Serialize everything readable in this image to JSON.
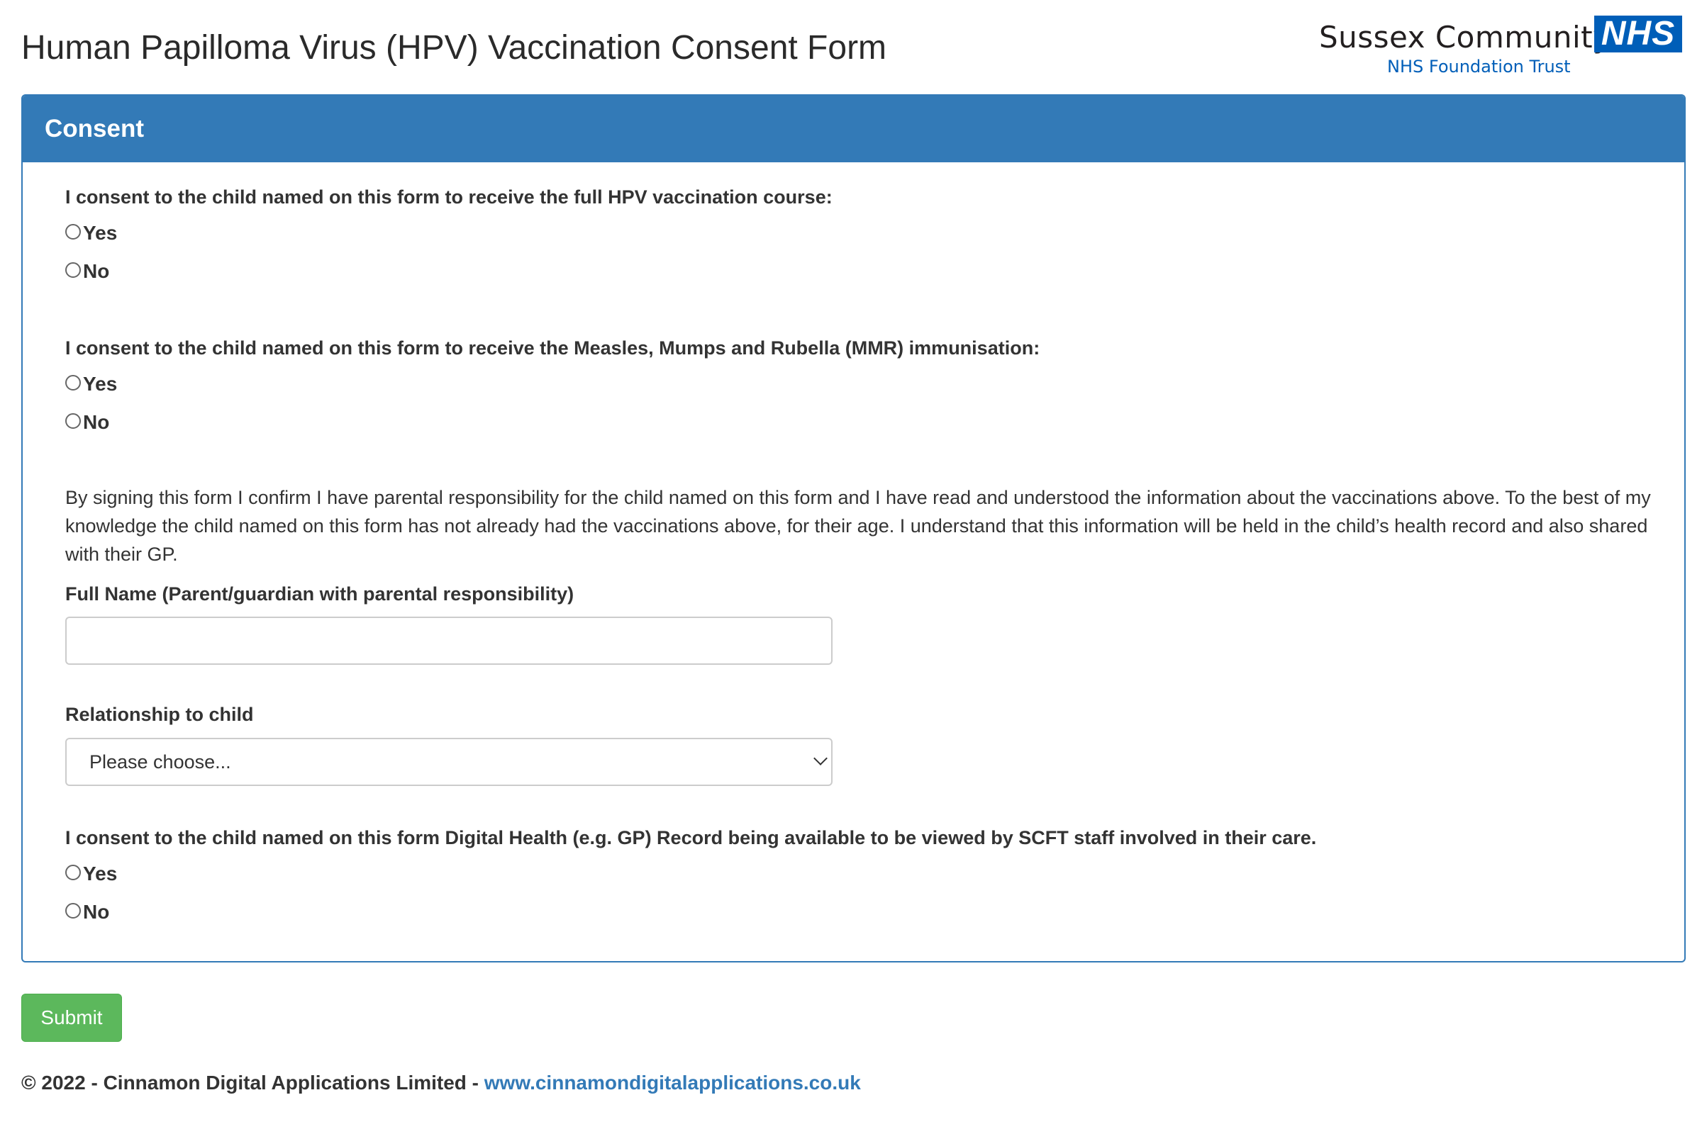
{
  "page": {
    "title": "Human Papilloma Virus (HPV) Vaccination Consent Form"
  },
  "logo": {
    "org_name": "Sussex Community",
    "nhs_mark": "NHS",
    "trust_name": "NHS Foundation Trust",
    "brand_color": "#005eb8"
  },
  "panel": {
    "heading": "Consent",
    "accent_color": "#337ab7"
  },
  "questions": {
    "hpv": {
      "label": "I consent to the child named on this form to receive the full HPV vaccination course:",
      "yes": "Yes",
      "no": "No"
    },
    "mmr": {
      "label": "I consent to the child named on this form to receive the Measles, Mumps and Rubella (MMR) immunisation:",
      "yes": "Yes",
      "no": "No"
    },
    "record": {
      "label": "I consent to the child named on this form Digital Health (e.g. GP) Record being available to be viewed by SCFT staff involved in their care.",
      "yes": "Yes",
      "no": "No"
    }
  },
  "declaration": "By signing this form I confirm I have parental responsibility for the child named on this form and I have read and understood the information about the vaccinations above. To the best of my knowledge the child named on this form has not already had the vaccinations above, for their age. I understand that this information will be held in the child’s health record and also shared with their GP.",
  "fields": {
    "full_name": {
      "label": "Full Name (Parent/guardian with parental responsibility)",
      "value": ""
    },
    "relationship": {
      "label": "Relationship to child",
      "selected": "Please choose..."
    }
  },
  "actions": {
    "submit_label": "Submit",
    "submit_color": "#5cb85c"
  },
  "footer": {
    "copyright": "© 2022 - Cinnamon Digital Applications Limited - ",
    "link_text": "www.cinnamondigitalapplications.co.uk"
  }
}
